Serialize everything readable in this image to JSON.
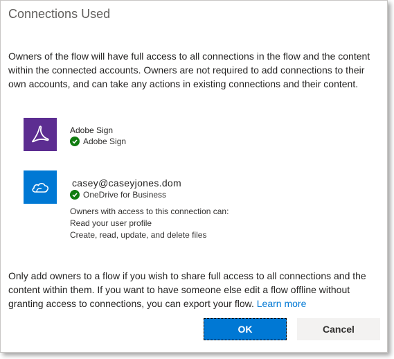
{
  "dialog": {
    "title": "Connections Used",
    "intro": "Owners of the flow will have full access to all connections in the flow and the content within the connected accounts. Owners are not required to add connections to their own accounts, and can take any actions in existing connections and their content.",
    "footer_text": "Only add owners to a flow if you wish to share full access to all connections and the content within them. If you want to have someone else edit a flow offline without granting access to connections, you can export your flow.",
    "learn_more": "Learn more"
  },
  "connections": [
    {
      "name": "Adobe Sign",
      "status_label": "Adobe Sign",
      "icon": "adobe-sign-icon",
      "color": "#5c2d91"
    },
    {
      "account": "casey@caseyjones.dom",
      "status_label": "OneDrive for Business",
      "icon": "onedrive-icon",
      "color": "#0078d4",
      "permissions_heading": "Owners with access to this connection can:",
      "permissions": [
        "Read your user profile",
        "Create, read, update, and delete files"
      ]
    }
  ],
  "buttons": {
    "ok": "OK",
    "cancel": "Cancel"
  },
  "colors": {
    "primary": "#0078d4",
    "success": "#107c10"
  }
}
